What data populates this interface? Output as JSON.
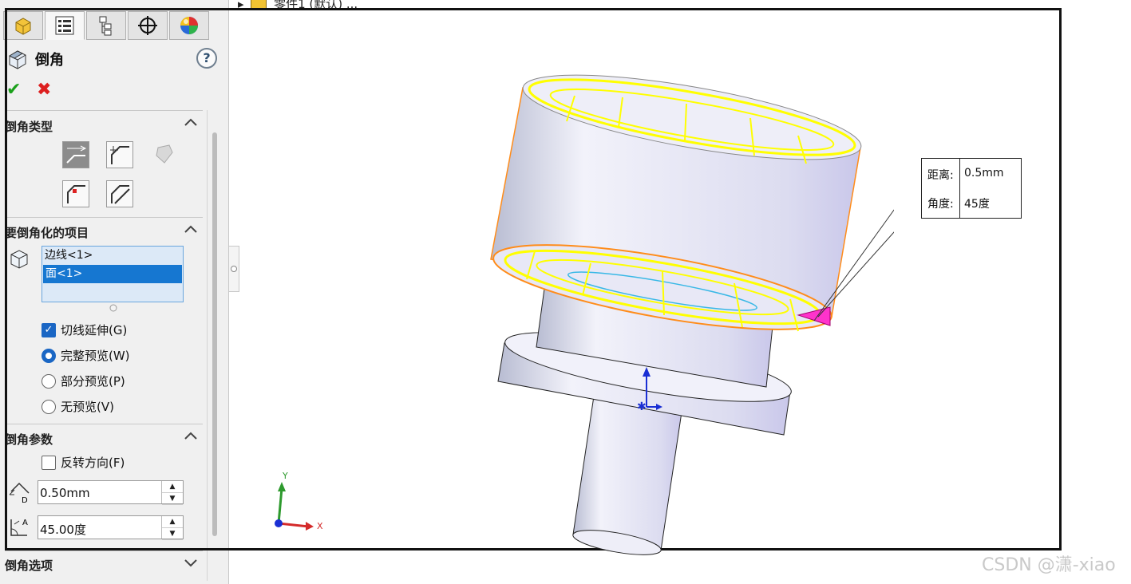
{
  "breadcrumb": "零件1 (默认) ...",
  "panel": {
    "title": "倒角",
    "help": "?",
    "ok": "✔",
    "cancel": "✖",
    "sections": {
      "type": "倒角类型",
      "items": "要倒角化的项目",
      "params": "倒角参数",
      "options": "倒角选项"
    },
    "items_list": [
      "边线<1>",
      "面<1>"
    ],
    "tangent_propagation": {
      "label": "切线延伸(G)",
      "checked": true
    },
    "preview": [
      {
        "label": "完整预览(W)",
        "selected": true
      },
      {
        "label": "部分预览(P)",
        "selected": false
      },
      {
        "label": "无预览(V)",
        "selected": false
      }
    ],
    "flip_direction": {
      "label": "反转方向(F)",
      "checked": false
    },
    "distance_value": "0.50mm",
    "angle_value": "45.00度",
    "distance_sub": "D",
    "angle_sub": "A"
  },
  "callout": {
    "distance_label": "距离:",
    "distance_value": "0.5mm",
    "angle_label": "角度:",
    "angle_value": "45度"
  },
  "triad": {
    "x": "X",
    "y": "Y"
  },
  "watermark": "CSDN @潇-xiao",
  "colors": {
    "highlight": "#ffff00",
    "selection": "#1677d1",
    "body": "#dcdcf0",
    "edge_orange": "#ff8c1a",
    "arrow": "#ff33cc"
  }
}
